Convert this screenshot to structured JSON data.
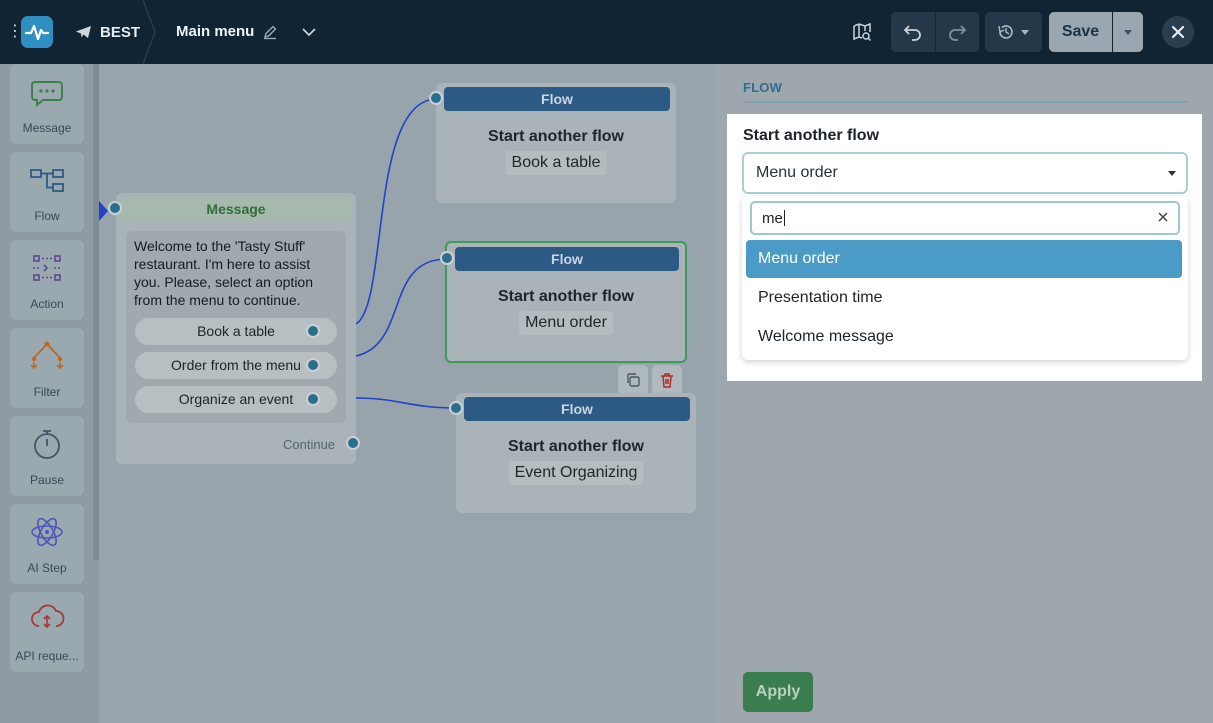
{
  "header": {
    "workspace": "BEST",
    "title": "Main menu",
    "save_label": "Save"
  },
  "sidebar": {
    "items": [
      {
        "label": "Message",
        "icon": "message-icon"
      },
      {
        "label": "Flow",
        "icon": "flow-icon"
      },
      {
        "label": "Action",
        "icon": "action-icon"
      },
      {
        "label": "Filter",
        "icon": "filter-icon"
      },
      {
        "label": "Pause",
        "icon": "pause-icon"
      },
      {
        "label": "AI Step",
        "icon": "ai-step-icon"
      },
      {
        "label": "API reque...",
        "icon": "api-request-icon"
      }
    ]
  },
  "canvas": {
    "message_node": {
      "header": "Message",
      "text": "Welcome to the 'Tasty Stuff' restaurant. I'm here to assist you. Please, select an option from the menu to continue.",
      "buttons": [
        "Book a table",
        "Order from the menu",
        "Organize an event"
      ],
      "continue_label": "Continue"
    },
    "flow_nodes": [
      {
        "header": "Flow",
        "title": "Start another flow",
        "subtitle": "Book a table"
      },
      {
        "header": "Flow",
        "title": "Start another flow",
        "subtitle": "Menu order"
      },
      {
        "header": "Flow",
        "title": "Start another flow",
        "subtitle": "Event Organizing"
      }
    ]
  },
  "panel": {
    "tab": "FLOW",
    "label": "Start another flow",
    "selected_value": "Menu order",
    "search_value": "me",
    "options": [
      "Menu order",
      "Presentation time",
      "Welcome message"
    ],
    "apply_label": "Apply"
  },
  "colors": {
    "topbar": "#102433",
    "accent": "#4a9cc6",
    "flow_header": "#2d5a84",
    "apply": "#3a7e4f",
    "wire": "#2242c9"
  }
}
